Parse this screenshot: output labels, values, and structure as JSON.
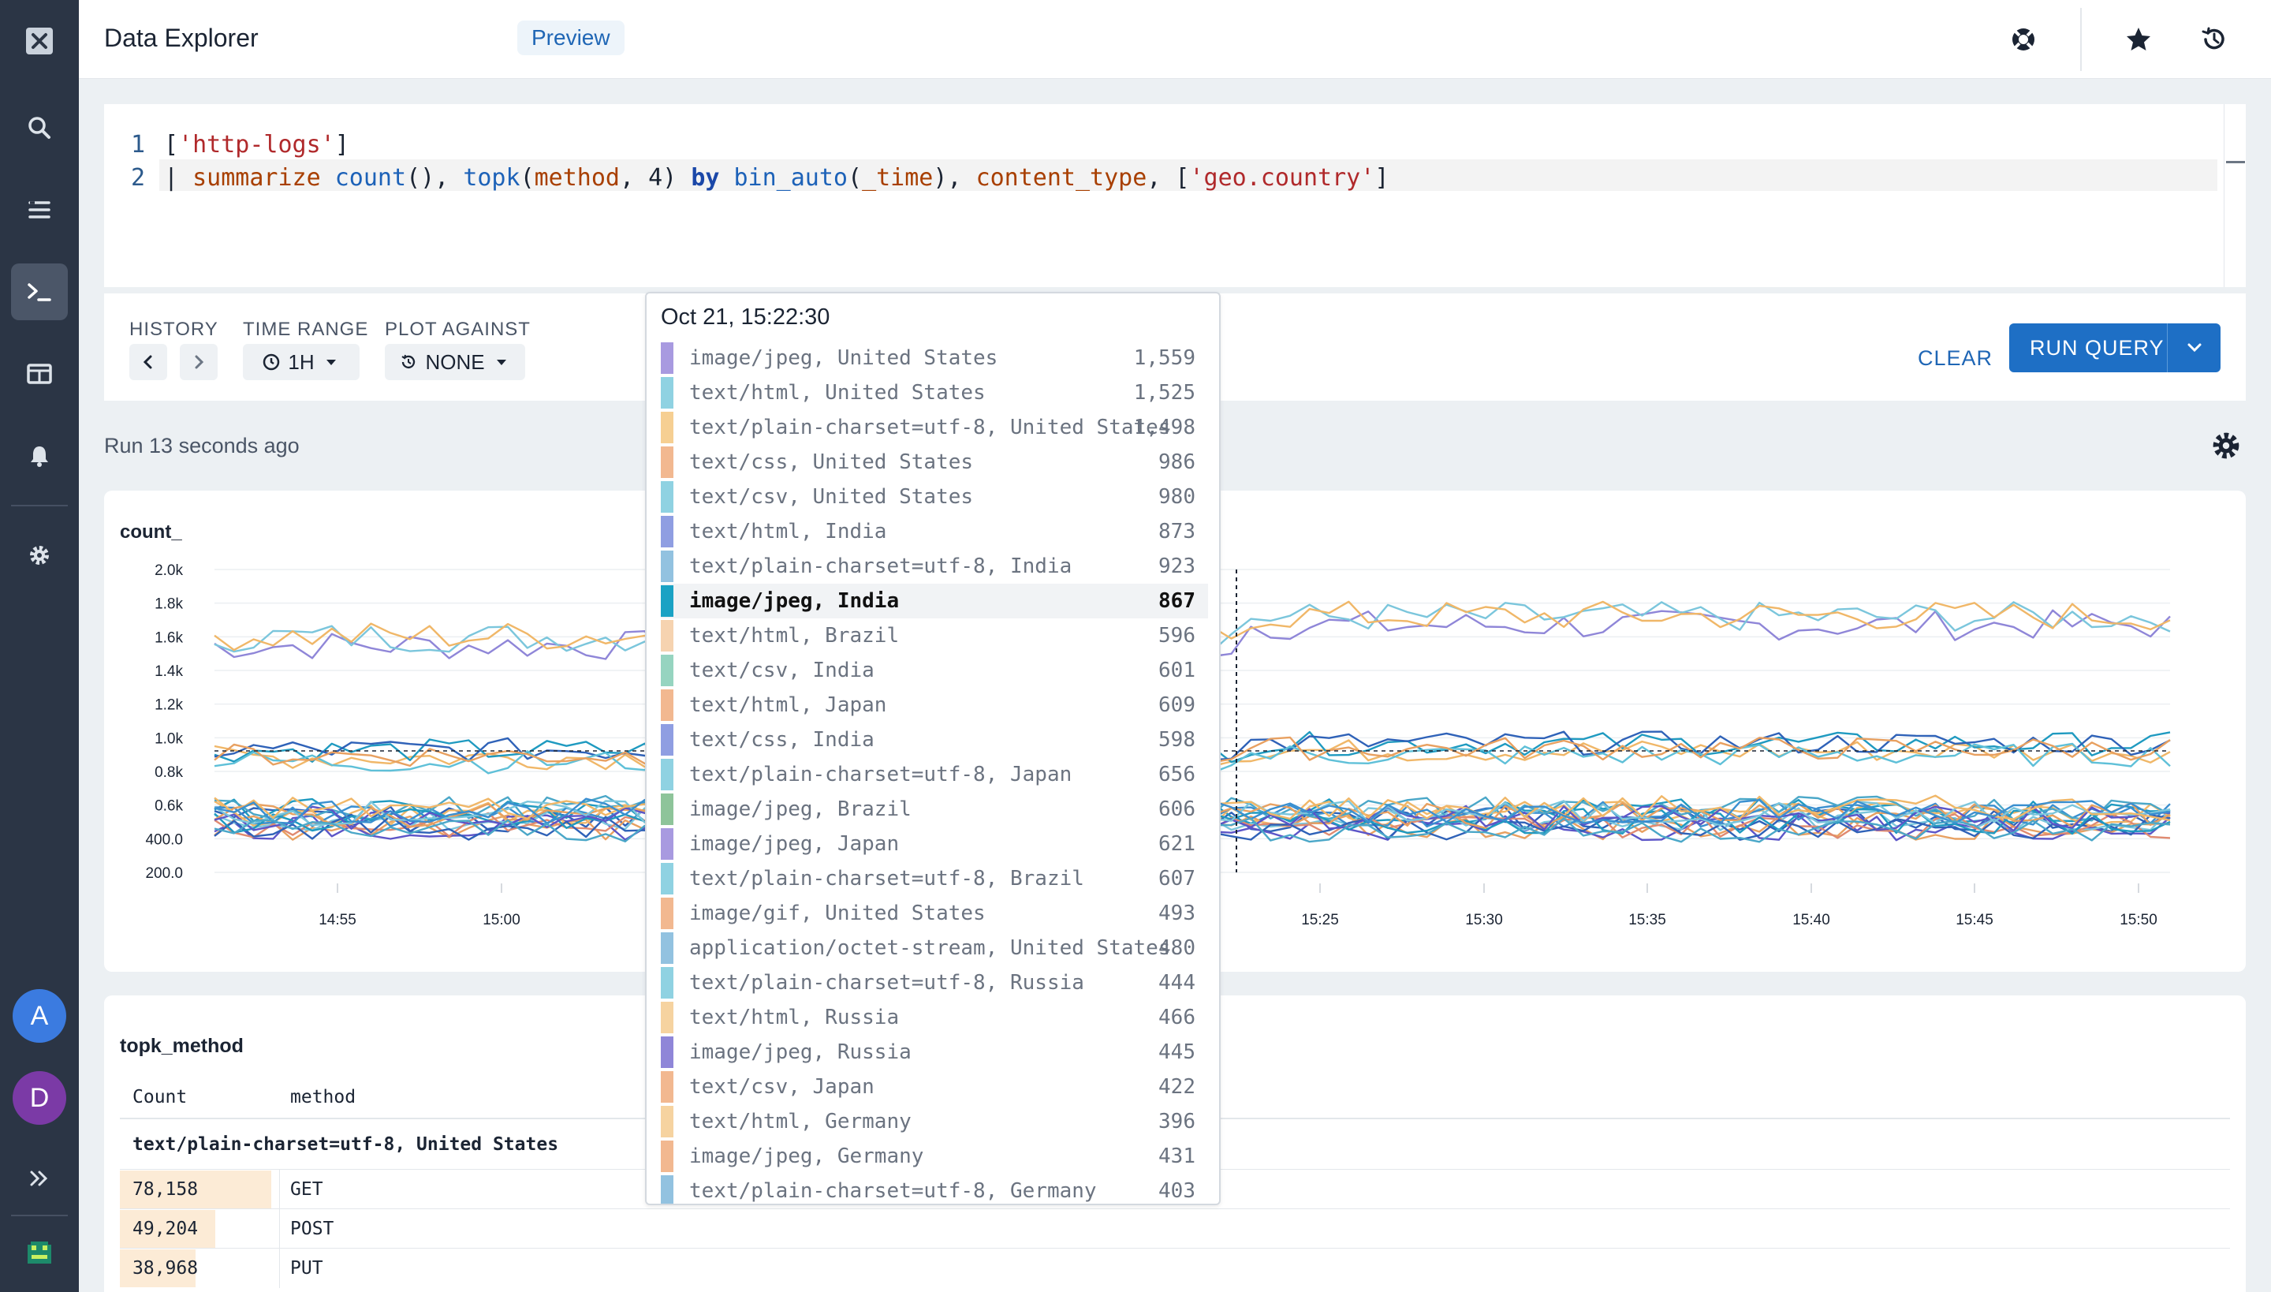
{
  "app": {
    "title": "Data Explorer",
    "badge": "Preview"
  },
  "sidebar": {
    "items": [
      "logo",
      "search",
      "datasets",
      "query",
      "dashboards",
      "monitors",
      "settings"
    ],
    "active": "query",
    "avatars": [
      {
        "letter": "A",
        "color": "#3b7be0"
      },
      {
        "letter": "D",
        "color": "#7b3aa6"
      }
    ],
    "expand_icon": "chevron-double-right-icon"
  },
  "editor": {
    "line_numbers": [
      "1",
      "2"
    ],
    "line1": {
      "open": "[",
      "str": "'http-logs'",
      "close": "]"
    },
    "line2": {
      "pipe": "| ",
      "summarize": "summarize",
      "count_fn": "count",
      "t1": "(), ",
      "topk_fn": "topk",
      "t2": "(",
      "method": "method",
      "t3": ", 4) ",
      "by": "by",
      "space": " ",
      "bin_fn": "bin_auto",
      "t4": "(",
      "time": "_time",
      "t5": "), ",
      "ctype": "content_type",
      "t6": ", [",
      "geo": "'geo.country'",
      "t7": "]"
    }
  },
  "toolbar": {
    "history_label": "HISTORY",
    "time_range_label": "TIME RANGE",
    "time_range_value": "1H",
    "plot_against_label": "PLOT AGAINST",
    "plot_against_value": "NONE",
    "clear_label": "CLEAR",
    "run_label": "RUN QUERY"
  },
  "run_status": "Run 13 seconds ago",
  "chart_data": {
    "type": "line",
    "title": "count_",
    "ylabel": "",
    "xlabel": "",
    "y_ticks": [
      "2.0k",
      "1.8k",
      "1.6k",
      "1.4k",
      "1.2k",
      "1.0k",
      "0.8k",
      "0.6k",
      "400.0",
      "200.0"
    ],
    "ylim": [
      200,
      2000
    ],
    "x_ticks": [
      "14:55",
      "15:00",
      "15:25",
      "15:30",
      "15:35",
      "15:40",
      "15:45",
      "15:50"
    ],
    "hover_time": "15:22:30",
    "hover_y_reference": 867,
    "series_bands": [
      {
        "level": 1550,
        "members": [
          "image/jpeg, United States",
          "text/html, United States",
          "text/plain-charset=utf-8, United States"
        ],
        "colors": [
          "#8f86d8",
          "#7bc6dc",
          "#f0b768"
        ]
      },
      {
        "level": 900,
        "members": [
          "text/css, United States",
          "text/csv, United States",
          "text/html, India",
          "text/plain-charset=utf-8, India",
          "image/jpeg, India"
        ],
        "colors": [
          "#f0b768",
          "#1f9ac0",
          "#2f62b8",
          "#5fc0d8",
          "#e8a060"
        ]
      },
      {
        "level": 520,
        "members": [
          "text/html, Brazil",
          "text/csv, India",
          "text/html, Japan",
          "text/css, India",
          "text/plain-charset=utf-8, Japan",
          "image/jpeg, Brazil",
          "image/jpeg, Japan",
          "text/plain-charset=utf-8, Brazil",
          "image/gif, United States",
          "application/octet-stream, United States",
          "text/plain-charset=utf-8, Russia",
          "text/html, Russia",
          "image/jpeg, Russia",
          "text/csv, Japan",
          "text/html, Germany",
          "image/jpeg, Germany",
          "text/plain-charset=utf-8, Germany"
        ],
        "colors": [
          "#2f62b8",
          "#1f9ac0",
          "#e8a060",
          "#5c55c8",
          "#7bc6dc",
          "#f0b768",
          "#3a8fd0",
          "#4aa7c8",
          "#e08a70"
        ]
      }
    ]
  },
  "tooltip": {
    "title": "Oct 21, 15:22:30",
    "rows": [
      {
        "label": "image/jpeg, United States",
        "value": "1,559",
        "color": "#a89ae0"
      },
      {
        "label": "text/html, United States",
        "value": "1,525",
        "color": "#8fd2e2"
      },
      {
        "label": "text/plain-charset=utf-8, United States",
        "value": "1,498",
        "color": "#f6cf92"
      },
      {
        "label": "text/css, United States",
        "value": "986",
        "color": "#f2b890"
      },
      {
        "label": "text/csv, United States",
        "value": "980",
        "color": "#8fd2e2"
      },
      {
        "label": "text/html, India",
        "value": "873",
        "color": "#8f9ee2"
      },
      {
        "label": "text/plain-charset=utf-8, India",
        "value": "923",
        "color": "#92c2e0"
      },
      {
        "label": "image/jpeg, India",
        "value": "867",
        "color": "#1aa2c4",
        "highlight": true
      },
      {
        "label": "text/html, Brazil",
        "value": "596",
        "color": "#f6d3b0"
      },
      {
        "label": "text/csv, India",
        "value": "601",
        "color": "#96d4c0"
      },
      {
        "label": "text/html, Japan",
        "value": "609",
        "color": "#f2b890"
      },
      {
        "label": "text/css, India",
        "value": "598",
        "color": "#8f9ee2"
      },
      {
        "label": "text/plain-charset=utf-8, Japan",
        "value": "656",
        "color": "#8fd2e2"
      },
      {
        "label": "image/jpeg, Brazil",
        "value": "606",
        "color": "#8ec49a"
      },
      {
        "label": "image/jpeg, Japan",
        "value": "621",
        "color": "#a89ae0"
      },
      {
        "label": "text/plain-charset=utf-8, Brazil",
        "value": "607",
        "color": "#8fd2e2"
      },
      {
        "label": "image/gif, United States",
        "value": "493",
        "color": "#f2b890"
      },
      {
        "label": "application/octet-stream, United States",
        "value": "480",
        "color": "#92c2e0"
      },
      {
        "label": "text/plain-charset=utf-8, Russia",
        "value": "444",
        "color": "#8fd2e2"
      },
      {
        "label": "text/html, Russia",
        "value": "466",
        "color": "#f6d3a0"
      },
      {
        "label": "image/jpeg, Russia",
        "value": "445",
        "color": "#8f86d8"
      },
      {
        "label": "text/csv, Japan",
        "value": "422",
        "color": "#f2b890"
      },
      {
        "label": "text/html, Germany",
        "value": "396",
        "color": "#f6d3a0"
      },
      {
        "label": "image/jpeg, Germany",
        "value": "431",
        "color": "#f2b890"
      },
      {
        "label": "text/plain-charset=utf-8, Germany",
        "value": "403",
        "color": "#92c2e0"
      }
    ]
  },
  "table": {
    "title": "topk_method",
    "headers": [
      "Count",
      "method"
    ],
    "group_label": "text/plain-charset=utf-8, United States",
    "rows": [
      {
        "count": "78,158",
        "method": "GET",
        "fraction": 1.0
      },
      {
        "count": "49,204",
        "method": "POST",
        "fraction": 0.63
      },
      {
        "count": "38,968",
        "method": "PUT",
        "fraction": 0.5
      }
    ]
  },
  "colors": {
    "sidebar_bg": "#2b3545",
    "accent": "#1e6fc5",
    "page_bg": "#ecf0f3"
  }
}
